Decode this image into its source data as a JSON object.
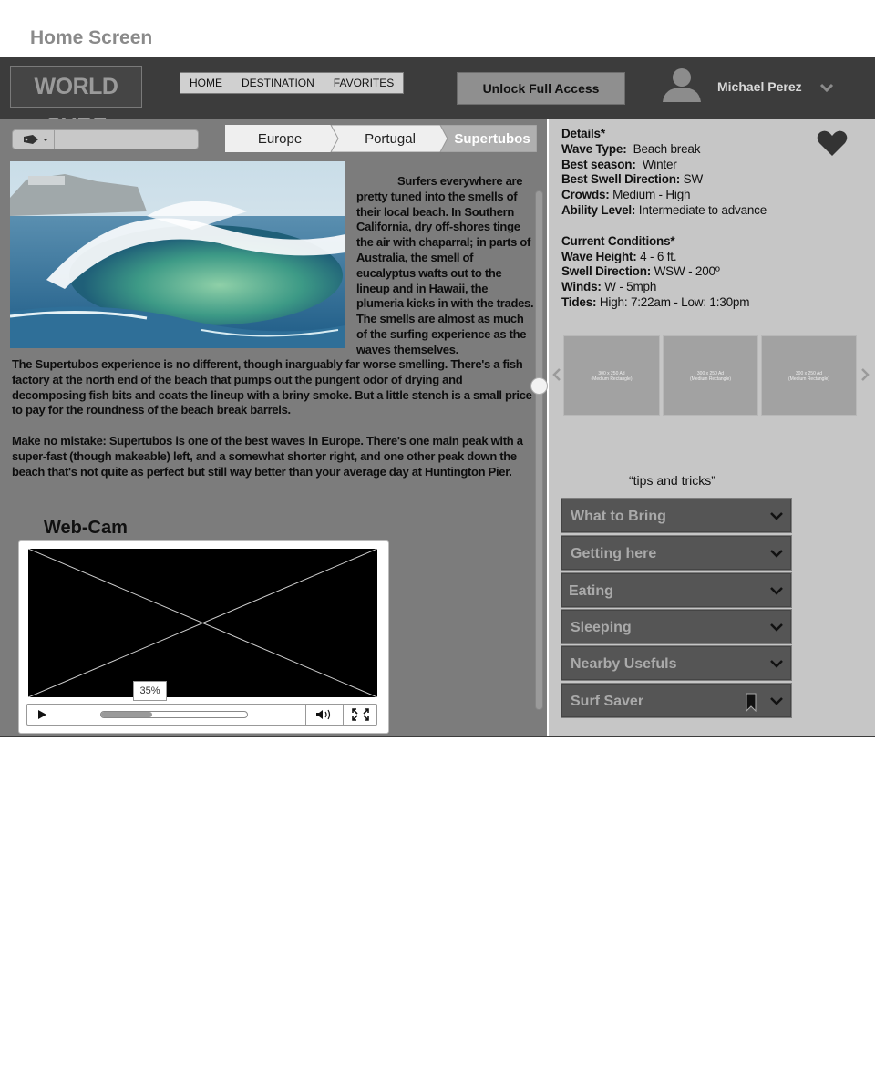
{
  "page": {
    "title": "Home Screen"
  },
  "header": {
    "logo": "WORLD SURF",
    "nav": [
      "HOME",
      "DESTINATION",
      "FAVORITES"
    ],
    "unlock_label": "Unlock Full Access",
    "user_name": "Michael Perez"
  },
  "breadcrumb": [
    "Europe",
    "Portugal",
    "Supertubos"
  ],
  "article": {
    "intro": "Surfers everywhere are pretty tuned into the smells of their local beach. In Southern California, dry off-shores tinge the air with chaparral; in parts of Australia, the smell of eucalyptus wafts out to the lineup and in Hawaii, the plumeria kicks in with the trades. The smells are almost as much of the surfing experience as the waves themselves.",
    "p1": "The Supertubos experience is no different, though inarguably far worse smelling. There's a fish factory at the north end of the beach that pumps out the pungent odor of drying and decomposing fish bits and coats the lineup with a briny smoke. But a little stench is a small price to pay for the roundness of the beach break barrels.",
    "p2": "Make no mistake: Supertubos is one of the best waves in Europe. There's one main peak with a super-fast (though makeable) left, and a somewhat shorter right, and one other peak down the beach that's not quite as perfect but still way better than your average day at Huntington Pier."
  },
  "webcam": {
    "title": "Web-Cam",
    "progress_label": "35%",
    "progress": 0.35
  },
  "details": {
    "heading": "Details*",
    "rows": [
      {
        "label": "Wave Type:",
        "value": "Beach break"
      },
      {
        "label": "Best season:",
        "value": "Winter"
      },
      {
        "label": "Best Swell Direction:",
        "value": "SW"
      },
      {
        "label": "Crowds:",
        "value": "Medium - High"
      },
      {
        "label": "Ability Level:",
        "value": "Intermediate to advance"
      }
    ]
  },
  "conditions": {
    "heading": "Current Conditions*",
    "rows": [
      {
        "label": "Wave Height:",
        "value": "4 - 6 ft."
      },
      {
        "label": "Swell Direction:",
        "value": "WSW - 200º"
      },
      {
        "label": "Winds:",
        "value": "W - 5mph"
      },
      {
        "label": "Tides:",
        "value": "High: 7:22am - Low: 1:30pm"
      }
    ]
  },
  "thumbnails": [
    {
      "size": "300 x 250 Ad",
      "name": "(Medium Rectangle)"
    },
    {
      "size": "300 x 250 Ad",
      "name": "(Medium Rectangle)"
    },
    {
      "size": "300 x 250 Ad",
      "name": "(Medium Rectangle)"
    }
  ],
  "tips": {
    "label": "“tips and tricks”",
    "items": [
      "What to Bring",
      "Getting here",
      "Eating",
      "Sleeping",
      "Nearby Usefuls",
      "Surf Saver"
    ]
  },
  "colors": {
    "topbar": "#3c3c3c",
    "left_panel": "#7c7c7c",
    "right_panel": "#c6c6c6",
    "accordion": "#555555"
  }
}
